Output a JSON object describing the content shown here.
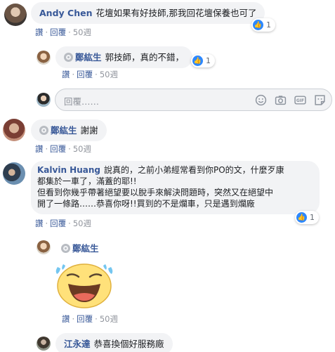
{
  "actions": {
    "like": "讚",
    "reply": "回覆",
    "sep": "·"
  },
  "comments": [
    {
      "author": "Andy Chen",
      "text": "花壇如果有好技師,那我回花壇保養也可了",
      "time": "50週",
      "reactions": "1"
    }
  ],
  "replies": [
    {
      "author": "鄭紘生",
      "text": "郭技師，真的不錯，",
      "time": "50週",
      "reactions": "1"
    }
  ],
  "reply_box": {
    "placeholder": "回覆……"
  },
  "comment2": {
    "author": "鄭紘生",
    "text": "謝謝",
    "time": "50週"
  },
  "comment3": {
    "author": "Kalvin Huang",
    "line1": "說真的，之前小弟經常看到你PO的文，什麼歹康",
    "line2": "都集於一車了，滿蓋的耶!!",
    "line3": "但看到你幾乎帶著絕望要以脫手來解決問題時，突然又在絕望中",
    "line4": "開了一條路……恭喜你呀!!買到的不是爛車，只是遇到爛廠",
    "time": "50週",
    "reactions": "1"
  },
  "reply2": {
    "author": "鄭紘生",
    "time": "50週",
    "sticker": "laughing-face-sticker"
  },
  "reply3": {
    "author": "江永達",
    "text": "恭喜換個好服務廠"
  }
}
